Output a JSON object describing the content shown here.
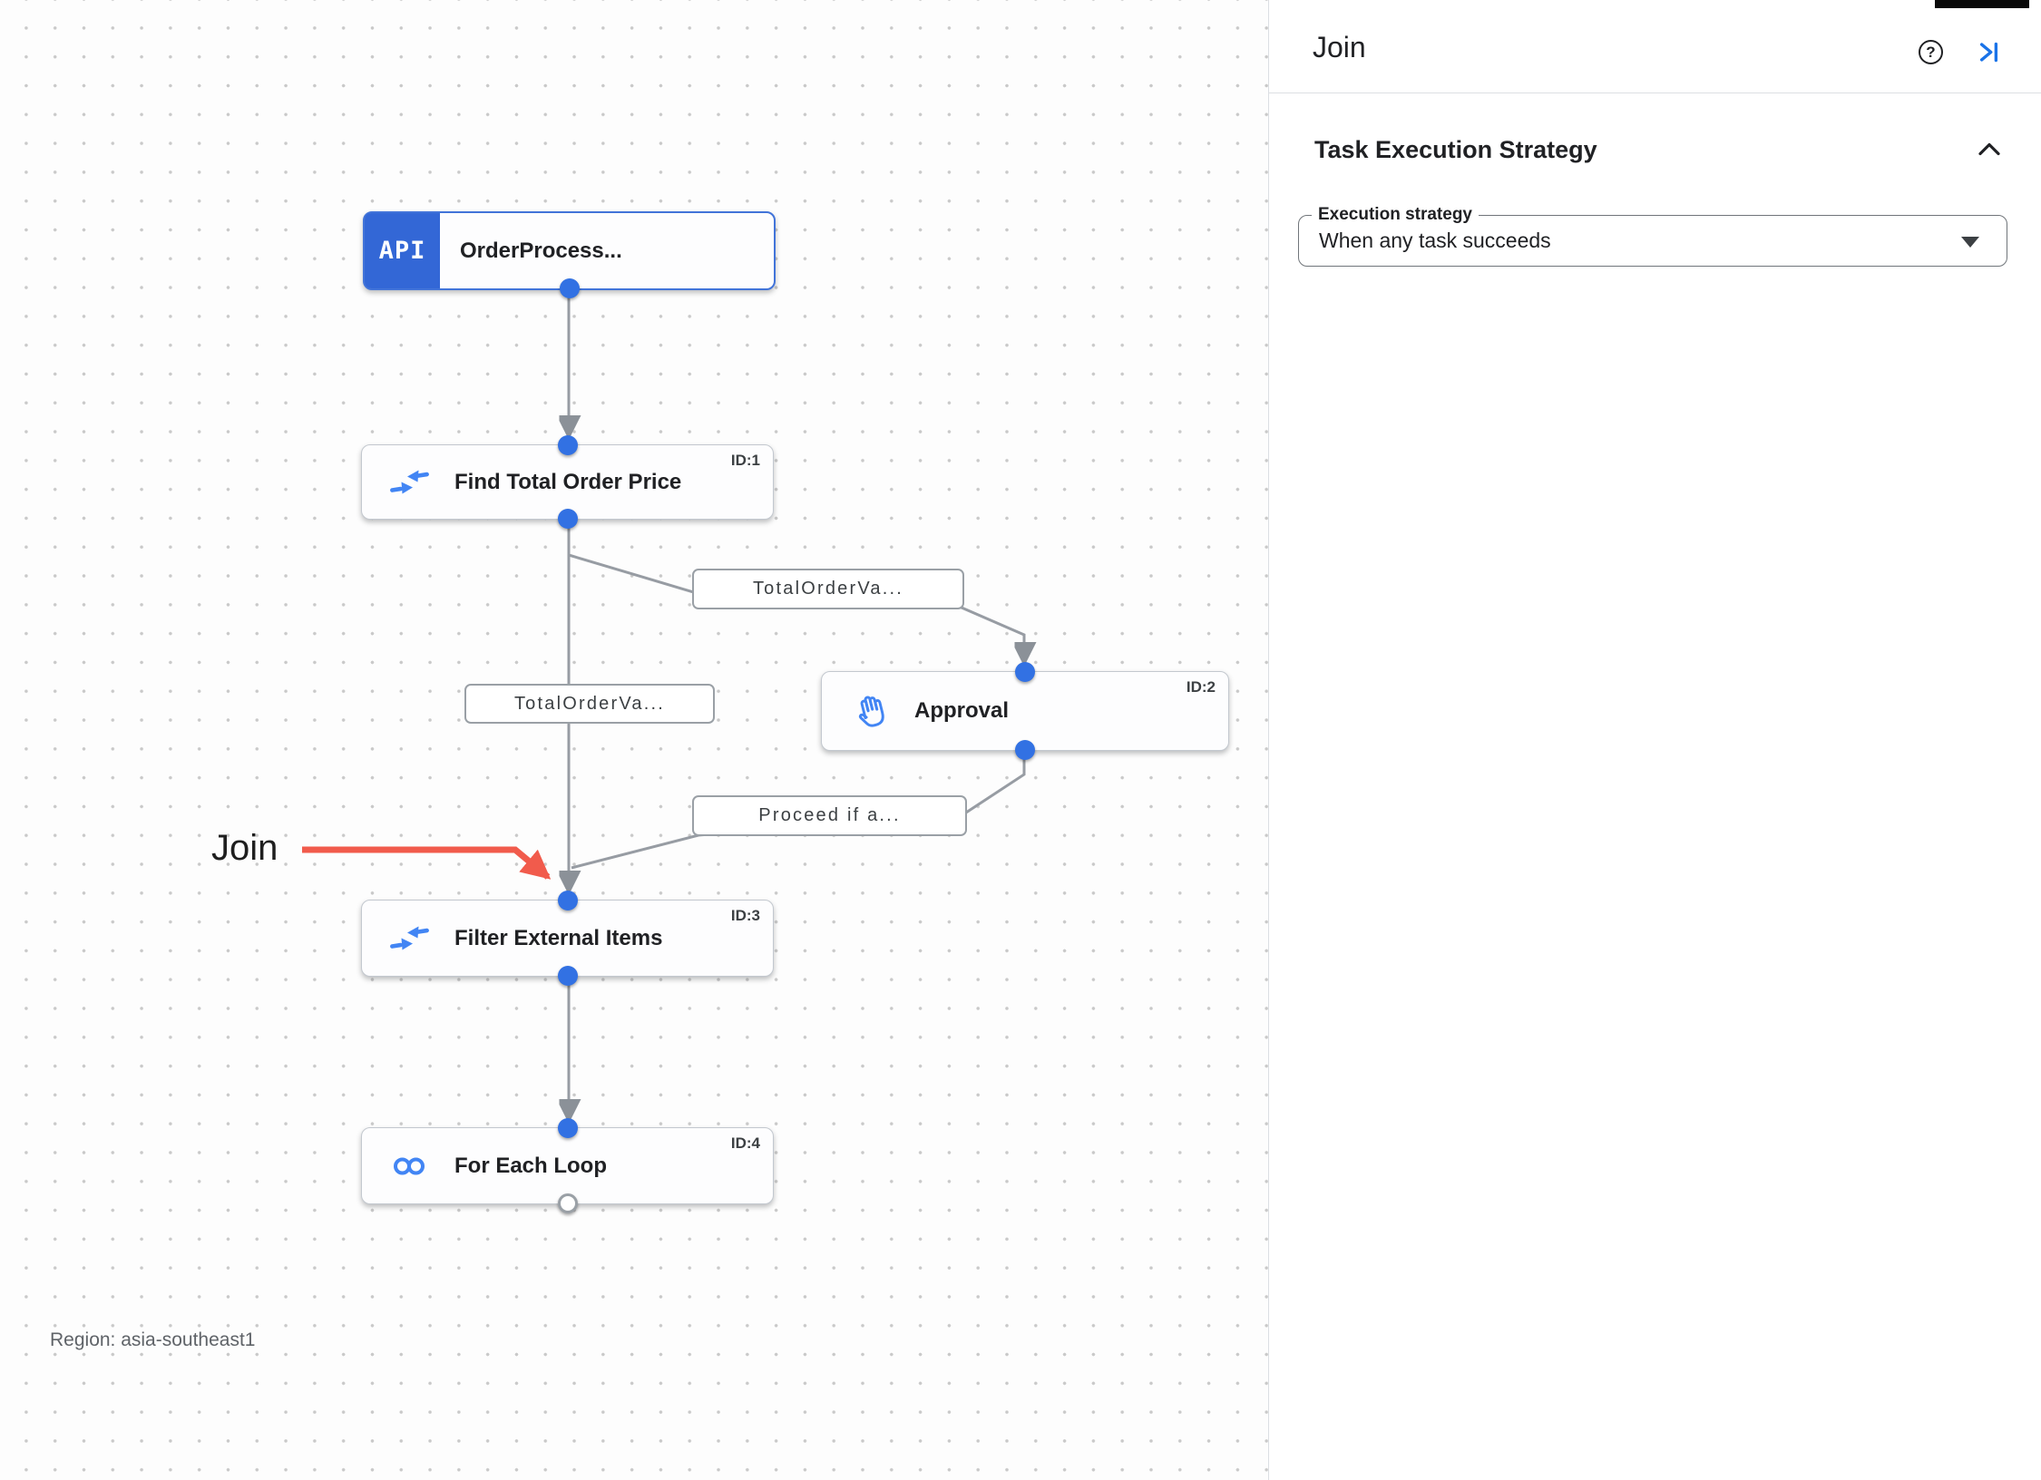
{
  "canvas": {
    "region_label": "Region: asia-southeast1",
    "annotation": {
      "label": "Join"
    },
    "nodes": [
      {
        "badge_text": "API",
        "title": "OrderProcess...",
        "id_label": ""
      },
      {
        "title": "Find Total Order Price",
        "id_label": "ID:1"
      },
      {
        "title": "Approval",
        "id_label": "ID:2"
      },
      {
        "title": "Filter External Items",
        "id_label": "ID:3"
      },
      {
        "title": "For Each Loop",
        "id_label": "ID:4"
      }
    ],
    "edge_labels": [
      "TotalOrderVa...",
      "TotalOrderVa...",
      "Proceed if a..."
    ]
  },
  "panel": {
    "title": "Join",
    "help_glyph": "?",
    "section": {
      "title": "Task Execution Strategy",
      "field_label": "Execution strategy",
      "field_value": "When any task succeeds"
    }
  },
  "colors": {
    "accent_blue": "#4285f4",
    "badge_blue": "#3367d6",
    "port_blue": "#3271e3",
    "edge_gray": "#979ca3",
    "annotation_red": "#f15b4c",
    "panel_icon_blue": "#1a73e8"
  }
}
